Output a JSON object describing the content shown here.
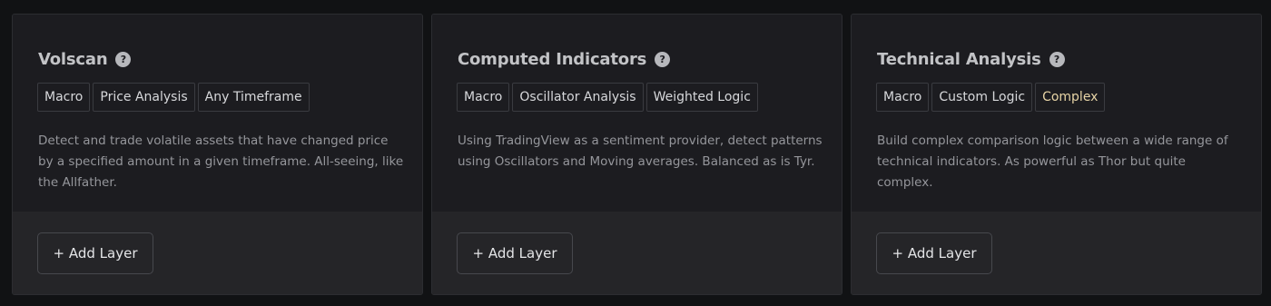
{
  "cards": [
    {
      "title": "Volscan",
      "help_icon": "?",
      "tags": [
        {
          "label": "Macro"
        },
        {
          "label": "Price Analysis"
        },
        {
          "label": "Any Timeframe"
        }
      ],
      "description": "Detect and trade volatile assets that have changed price by a specified amount in a given timeframe. All-seeing, like the Allfather.",
      "button_label": "+ Add Layer"
    },
    {
      "title": "Computed Indicators",
      "help_icon": "?",
      "tags": [
        {
          "label": "Macro"
        },
        {
          "label": "Oscillator Analysis"
        },
        {
          "label": "Weighted Logic"
        }
      ],
      "description": "Using TradingView as a sentiment provider, detect patterns using Oscillators and Moving averages. Balanced as is Tyr.",
      "button_label": "+ Add Layer"
    },
    {
      "title": "Technical Analysis",
      "help_icon": "?",
      "tags": [
        {
          "label": "Macro"
        },
        {
          "label": "Custom Logic"
        },
        {
          "label": "Complex",
          "highlight_color": "#e7d4a6"
        }
      ],
      "description": "Build complex comparison logic between a wide range of technical indicators. As powerful as Thor but quite complex.",
      "button_label": "+ Add Layer"
    }
  ],
  "colors": {
    "background": "#111214",
    "card_top": "#1c1c20",
    "card_bottom": "#252528",
    "tag_highlight": "#e7d4a6"
  }
}
